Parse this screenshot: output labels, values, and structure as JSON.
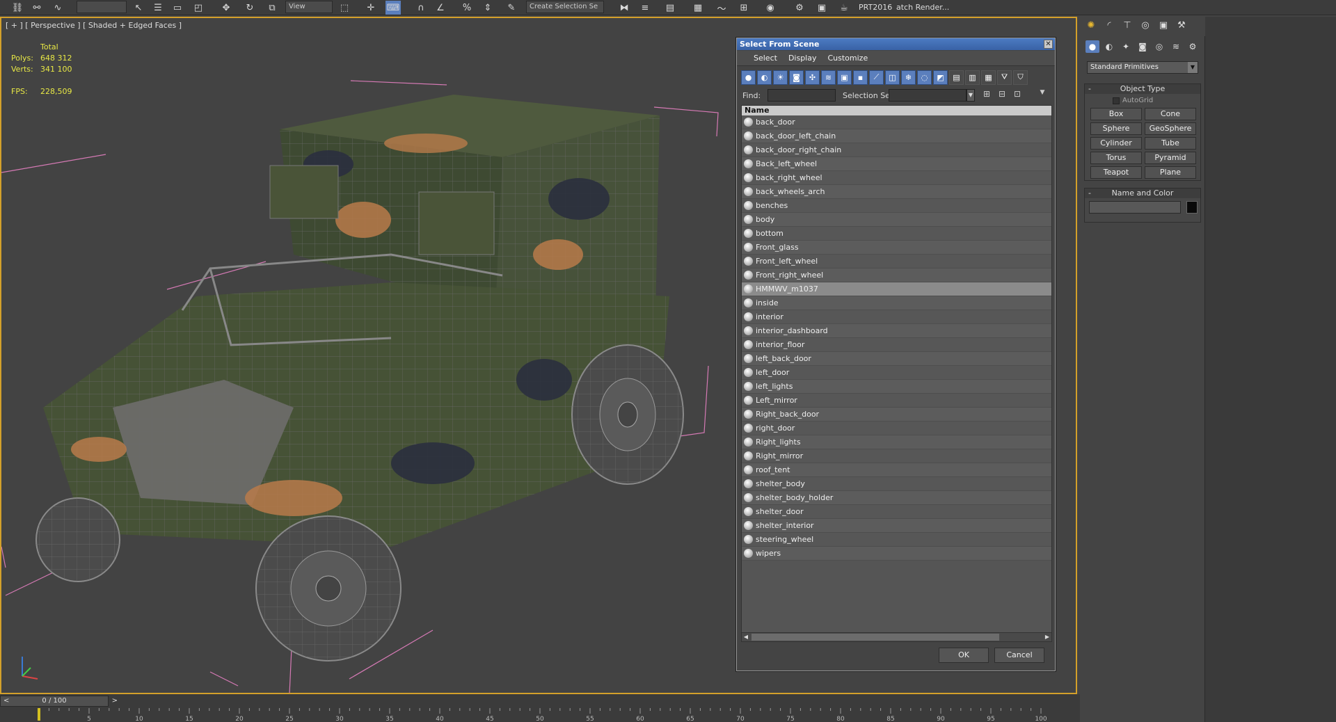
{
  "toolbar": {
    "view_dropdown": "View",
    "selection_set_dropdown": "Create Selection Se",
    "prt_label": "PRT2016",
    "batch_render_label": "atch Render..."
  },
  "viewport": {
    "label": "[ + ] [ Perspective ] [ Shaded + Edged Faces ]",
    "stats": {
      "total_label": "Total",
      "polys_label": "Polys:",
      "polys_value": "648 312",
      "verts_label": "Verts:",
      "verts_value": "341 100",
      "fps_label": "FPS:",
      "fps_value": "228,509"
    },
    "highlight_color": "#d4a02a"
  },
  "dialog": {
    "title": "Select From Scene",
    "close_glyph": "✕",
    "menu": [
      "Select",
      "Display",
      "Customize"
    ],
    "find_label": "Find:",
    "find_value": "",
    "selection_set_label": "Selection Set:",
    "selection_set_value": "",
    "column_name": "Name",
    "items": [
      "back_door",
      "back_door_left_chain",
      "back_door_right_chain",
      "Back_left_wheel",
      "back_right_wheel",
      "back_wheels_arch",
      "benches",
      "body",
      "bottom",
      "Front_glass",
      "Front_left_wheel",
      "Front_right_wheel",
      "HMMWV_m1037",
      "inside",
      "interior",
      "interior_dashboard",
      "interior_floor",
      "left_back_door",
      "left_door",
      "left_lights",
      "Left_mirror",
      "Right_back_door",
      "right_door",
      "Right_lights",
      "Right_mirror",
      "roof_tent",
      "shelter_body",
      "shelter_body_holder",
      "shelter_door",
      "shelter_interior",
      "steering_wheel",
      "wipers"
    ],
    "selected_item": "HMMWV_m1037",
    "ok_label": "OK",
    "cancel_label": "Cancel"
  },
  "command_panel": {
    "primitive_dropdown": "Standard Primitives",
    "object_type_title": "Object Type",
    "autogrid_label": "AutoGrid",
    "object_buttons": [
      "Box",
      "Cone",
      "Sphere",
      "GeoSphere",
      "Cylinder",
      "Tube",
      "Torus",
      "Pyramid",
      "Teapot",
      "Plane"
    ],
    "name_color_title": "Name and Color",
    "name_value": "",
    "color_swatch": "#0a0a0a",
    "rollout_minus": "-"
  },
  "timeline": {
    "slider_text": "0 / 100",
    "left_arrow": "<",
    "right_arrow": ">",
    "ticks": [
      5,
      10,
      15,
      20,
      25,
      30,
      35,
      40,
      45,
      50,
      55,
      60,
      65,
      70,
      75,
      80,
      85,
      90,
      95,
      100
    ]
  }
}
